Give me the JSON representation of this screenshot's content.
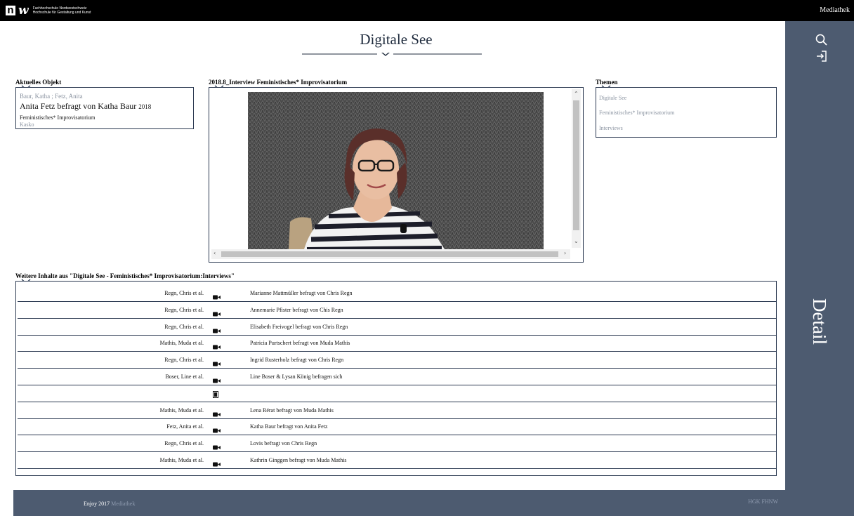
{
  "header": {
    "logo_letters": "n w",
    "logo_line1": "Fachhochschule Nordwestschweiz",
    "logo_line2": "Hochschule für Gestaltung und Kunst",
    "mediathek_link": "Mediathek"
  },
  "page_title": "Digitale See",
  "sidebar": {
    "label": "Detail",
    "icons": [
      "search-icon",
      "login-icon"
    ]
  },
  "current_object": {
    "heading": "Aktuelles Objekt",
    "authors": "Baur, Katha ; Fetz, Anita",
    "title": "Anita Fetz befragt von Katha Baur",
    "year": "2018",
    "project": "Feministisches* Improvisatorium",
    "kasko": "Kasko"
  },
  "video": {
    "heading": "2018.8_Interview Feministisches* Improvisatorium"
  },
  "themes": {
    "heading": "Themen",
    "items": [
      "Digitale See",
      "Feministisches* Improvisatorium",
      "Interviews"
    ]
  },
  "more": {
    "heading": "Weitere Inhalte aus \"Digitale See - Feministisches* Improvisatorium:Interviews\"",
    "rows": [
      {
        "author": "Regn, Chris et al.",
        "icon": "video-camera-icon",
        "title": "Marianne Mattmüller befragt von Chris Regn"
      },
      {
        "author": "Regn, Chris et al.",
        "icon": "video-camera-icon",
        "title": "Annemarie Pfister befragt von Chis Regn"
      },
      {
        "author": "Regn, Chris et al.",
        "icon": "video-camera-icon",
        "title": "Elisabeth Freivogel befragt von Chris Regn"
      },
      {
        "author": "Mathis, Muda et al.",
        "icon": "video-camera-icon",
        "title": "Patricia Purtschert befragt von Muda Mathis"
      },
      {
        "author": "Regn, Chris et al.",
        "icon": "video-camera-icon",
        "title": "Ingrid Rusterholz befragt von Chris Regn"
      },
      {
        "author": "Boser, Line et al.",
        "icon": "video-camera-icon",
        "title": "Line Boser & Lysan König befragen sich"
      },
      {
        "author": "",
        "icon": "document-icon",
        "title": ""
      },
      {
        "author": "Mathis, Muda et al.",
        "icon": "video-camera-icon",
        "title": "Lena Rérat befragt von Muda Mathis"
      },
      {
        "author": "Fetz, Anita et al.",
        "icon": "video-camera-icon",
        "title": "Katha Baur befragt von Anita Fetz"
      },
      {
        "author": "Regn, Chris et al.",
        "icon": "video-camera-icon",
        "title": "Lovis befragt von Chris Regn"
      },
      {
        "author": "Mathis, Muda et al.",
        "icon": "video-camera-icon",
        "title": "Kathrin Ginggen befragt von Muda Mathis"
      }
    ]
  },
  "footer": {
    "enjoy": "Enjoy 2017",
    "enjoy_link": "Mediathek",
    "right": "HGK FHNW"
  },
  "colors": {
    "sidebar": "#4d5b70",
    "border": "#2a3850",
    "muted_text": "#8a93a0"
  }
}
